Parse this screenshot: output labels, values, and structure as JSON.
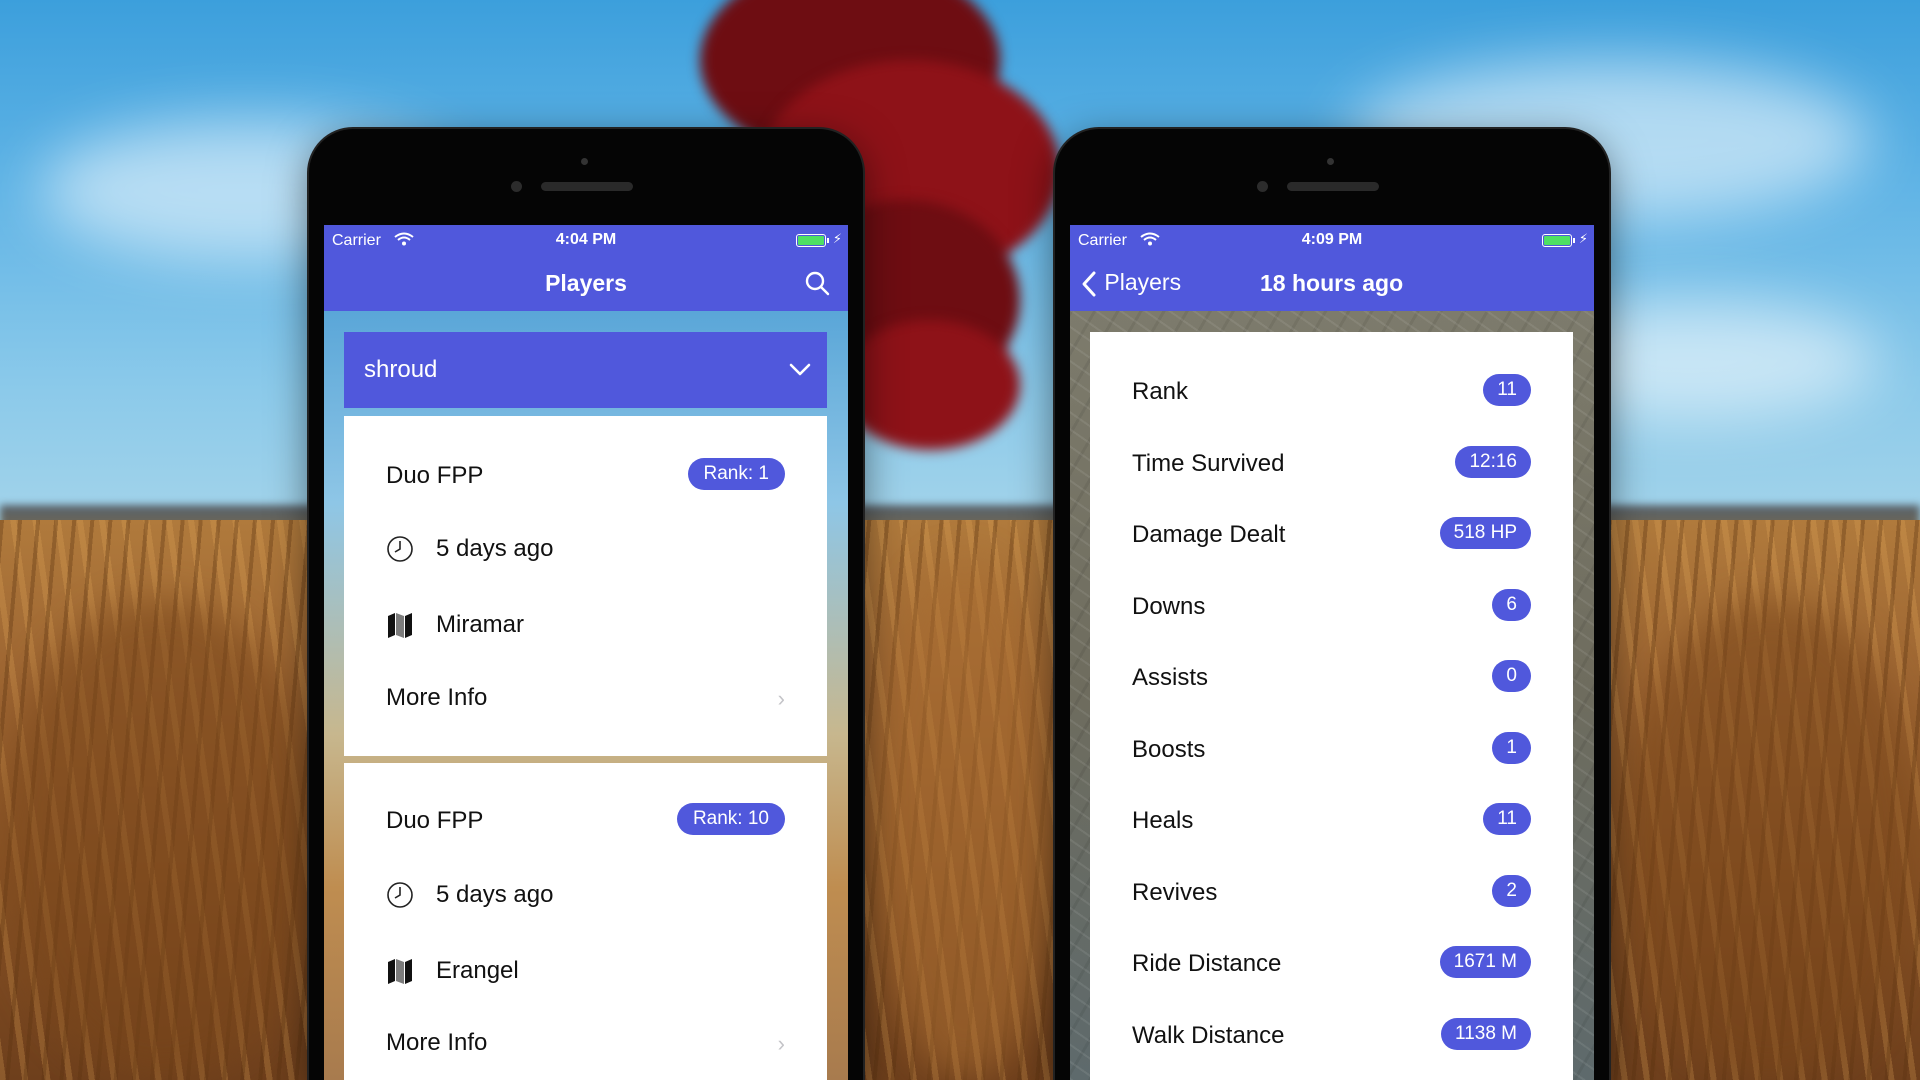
{
  "left_phone": {
    "status": {
      "carrier": "Carrier",
      "time": "4:04 PM"
    },
    "nav": {
      "title": "Players"
    },
    "dropdown": {
      "selected": "shroud"
    },
    "matches": [
      {
        "mode": "Duo FPP",
        "rank": "Rank: 1",
        "when": "5 days ago",
        "map": "Miramar",
        "more": "More Info"
      },
      {
        "mode": "Duo FPP",
        "rank": "Rank: 10",
        "when": "5 days ago",
        "map": "Erangel",
        "more": "More Info"
      }
    ]
  },
  "right_phone": {
    "status": {
      "carrier": "Carrier",
      "time": "4:09 PM"
    },
    "nav": {
      "back": "Players",
      "title": "18 hours ago"
    },
    "stats": [
      {
        "label": "Rank",
        "value": "11"
      },
      {
        "label": "Time Survived",
        "value": "12:16"
      },
      {
        "label": "Damage Dealt",
        "value": "518 HP"
      },
      {
        "label": "Downs",
        "value": "6"
      },
      {
        "label": "Assists",
        "value": "0"
      },
      {
        "label": "Boosts",
        "value": "1"
      },
      {
        "label": "Heals",
        "value": "11"
      },
      {
        "label": "Revives",
        "value": "2"
      },
      {
        "label": "Ride Distance",
        "value": "1671 M"
      },
      {
        "label": "Walk Distance",
        "value": "1138 M"
      }
    ]
  },
  "colors": {
    "accent": "#5058dc",
    "battery": "#4ee064"
  },
  "icons": [
    "wifi-icon",
    "battery-icon",
    "search-icon",
    "chevron-down-icon",
    "clock-icon",
    "map-icon",
    "chevron-right-icon",
    "back-chevron-icon"
  ]
}
